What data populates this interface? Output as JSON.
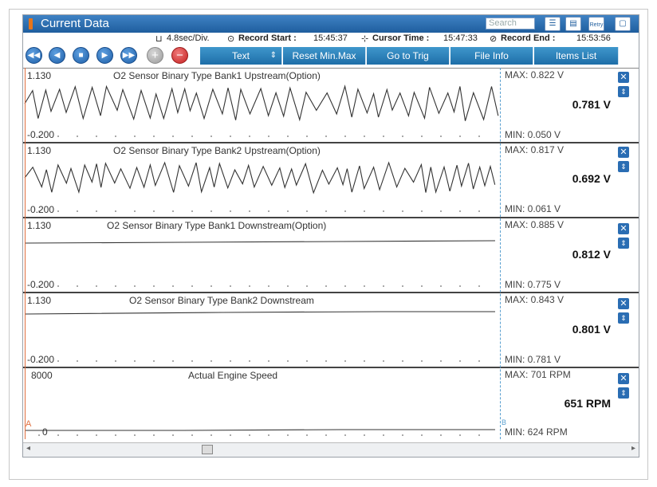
{
  "window": {
    "title": "Current Data"
  },
  "search": {
    "placeholder": "Search"
  },
  "toolbar_icons": [
    "list-icon",
    "grid-icon",
    "retry-icon",
    "maximize-icon"
  ],
  "retry_label": "Retry",
  "info": {
    "div": "4.8sec/Div.",
    "record_start_label": "Record Start :",
    "record_start": "15:45:37",
    "cursor_time_label": "Cursor Time :",
    "cursor_time": "15:47:33",
    "record_end_label": "Record End :",
    "record_end": "15:53:56"
  },
  "buttons": {
    "text": "Text",
    "reset": "Reset Min.Max",
    "goto": "Go to Trig",
    "fileinfo": "File Info",
    "items": "Items List"
  },
  "playback_icons": [
    "rewind-icon",
    "prev-icon",
    "stop-icon",
    "play-icon",
    "fast-forward-icon",
    "zoom-in-icon",
    "zoom-out-icon"
  ],
  "rows": [
    {
      "title": "O2 Sensor Binary Type Bank1 Upstream(Option)",
      "max_axis": "1.130",
      "min_axis": "-0.200",
      "max": "MAX: 0.822 V",
      "min": "MIN: 0.050 V",
      "value": "0.781 V"
    },
    {
      "title": "O2 Sensor Binary Type Bank2 Upstream(Option)",
      "max_axis": "1.130",
      "min_axis": "-0.200",
      "max": "MAX: 0.817 V",
      "min": "MIN: 0.061 V",
      "value": "0.692 V"
    },
    {
      "title": "O2 Sensor Binary Type Bank1 Downstream(Option)",
      "max_axis": "1.130",
      "min_axis": "-0.200",
      "max": "MAX: 0.885 V",
      "min": "MIN: 0.775 V",
      "value": "0.812 V"
    },
    {
      "title": "O2 Sensor Binary Type Bank2 Downstream",
      "max_axis": "1.130",
      "min_axis": "-0.200",
      "max": "MAX: 0.843 V",
      "min": "MIN: 0.781 V",
      "value": "0.801 V"
    },
    {
      "title": "Actual Engine Speed",
      "max_axis": "8000",
      "min_axis": "0",
      "max": "MAX:   701 RPM",
      "min": "MIN:   624 RPM",
      "value": "651 RPM"
    }
  ],
  "cursor_a": "A",
  "cursor_b": "B",
  "colors": {
    "titlebar": "#1f5e9e",
    "button": "#1e6ea8",
    "cursor_line": "#5aa0d0",
    "trace": "#333333"
  }
}
